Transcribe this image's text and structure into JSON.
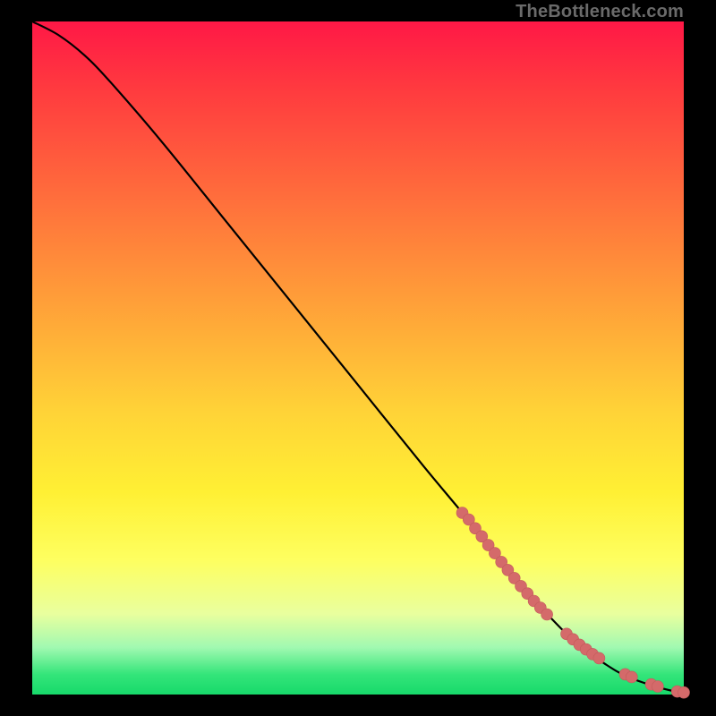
{
  "attribution": "TheBottleneck.com",
  "colors": {
    "curve": "#000000",
    "marker_fill": "#d46a6a",
    "marker_stroke": "#c25b5b"
  },
  "chart_data": {
    "type": "line",
    "title": "",
    "xlabel": "",
    "ylabel": "",
    "xlim": [
      0,
      100
    ],
    "ylim": [
      0,
      100
    ],
    "curve": {
      "x": [
        0,
        4,
        8,
        12,
        20,
        30,
        40,
        50,
        60,
        66,
        70,
        74,
        78,
        82,
        85,
        88,
        90,
        92,
        94,
        96,
        98,
        100
      ],
      "y": [
        100,
        98,
        95,
        91,
        82,
        70,
        58,
        46,
        34,
        27,
        22,
        17,
        13,
        9,
        6.5,
        4.5,
        3.3,
        2.4,
        1.7,
        1.1,
        0.6,
        0.3
      ]
    },
    "markers": {
      "x": [
        66,
        67,
        68,
        69,
        70,
        71,
        72,
        73,
        74,
        75,
        76,
        77,
        78,
        79,
        82,
        83,
        84,
        85,
        86,
        87,
        91,
        92,
        95,
        96,
        99,
        100
      ],
      "y": [
        27,
        26,
        24.7,
        23.5,
        22.2,
        21,
        19.7,
        18.5,
        17.3,
        16.1,
        15,
        13.9,
        12.9,
        11.9,
        9.0,
        8.2,
        7.4,
        6.7,
        6.0,
        5.4,
        3.0,
        2.6,
        1.5,
        1.2,
        0.45,
        0.3
      ]
    }
  }
}
